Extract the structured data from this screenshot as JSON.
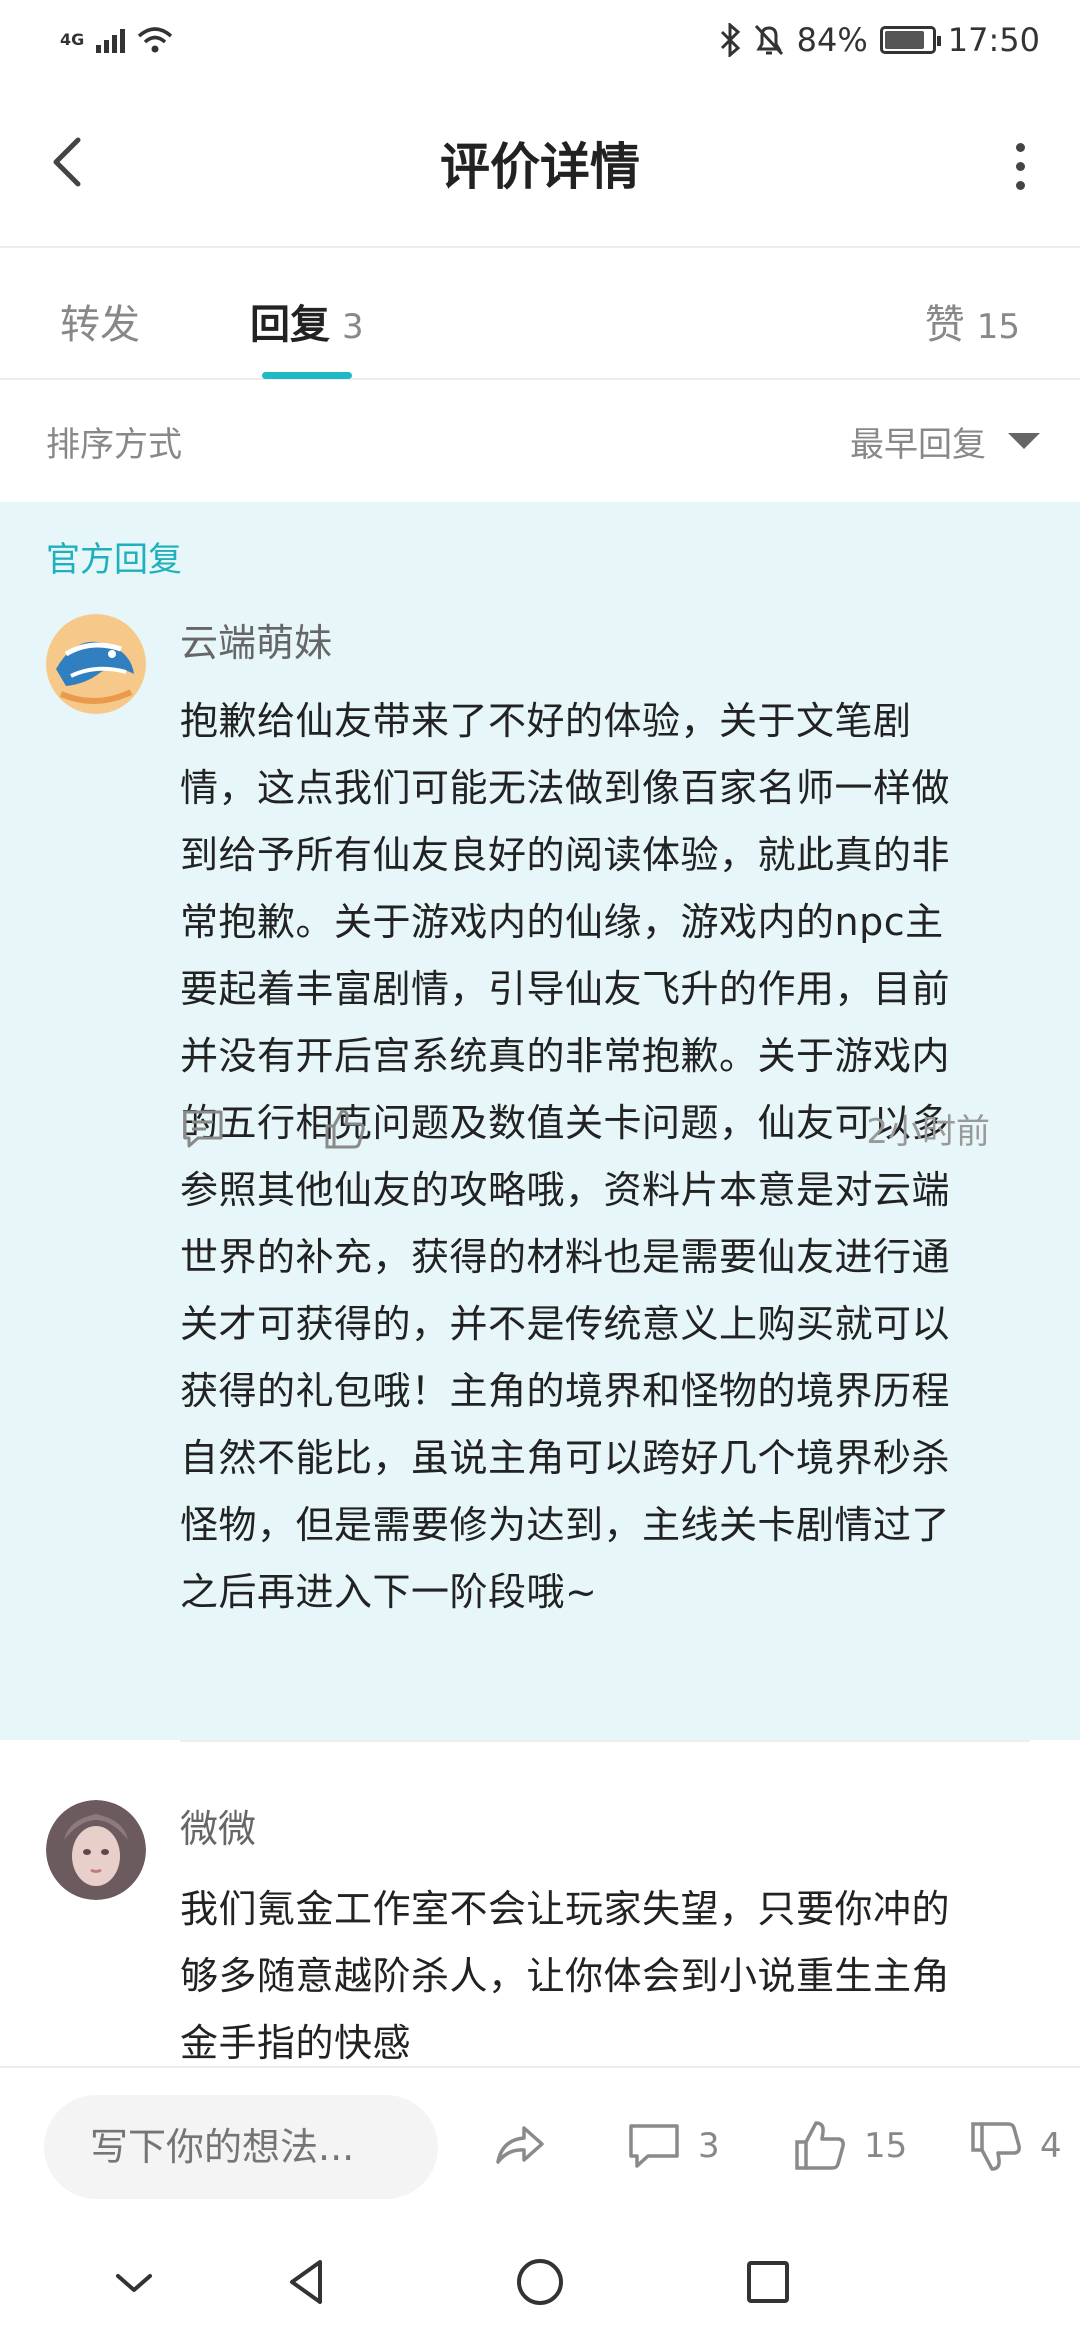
{
  "status_bar": {
    "network": "4G",
    "battery_percent": "84%",
    "battery_level": 0.84,
    "time": "17:50"
  },
  "header": {
    "title": "评价详情"
  },
  "tabs": [
    {
      "label": "转发",
      "count": ""
    },
    {
      "label": "回复",
      "count": "3"
    },
    {
      "label": "赞",
      "count": "15"
    }
  ],
  "sort": {
    "label": "排序方式",
    "value": "最早回复"
  },
  "official_reply": {
    "tag": "官方回复",
    "username": "云端萌妹",
    "lines": [
      "抱歉给仙友带来了不好的体验，关于文笔剧",
      "情，这点我们可能无法做到像百家名师一样做",
      "到给予所有仙友良好的阅读体验，就此真的非",
      "常抱歉。关于游戏内的仙缘，游戏内的npc主",
      "要起着丰富剧情，引导仙友飞升的作用，目前",
      "并没有开后宫系统真的非常抱歉。关于游戏内",
      "的五行相克问题及数值关卡问题，仙友可以多",
      "参照其他仙友的攻略哦，资料片本意是对云端",
      "世界的补充，获得的材料也是需要仙友进行通",
      "关才可获得的，并不是传统意义上购买就可以",
      "获得的礼包哦！主角的境界和怪物的境界历程",
      "自然不能比，虽说主角可以跨好几个境界秒杀",
      "怪物，但是需要修为达到，主线关卡剧情过了",
      "之后再进入下一阶段哦~"
    ],
    "time": "2小时前"
  },
  "reply_2": {
    "username": "微微",
    "lines": [
      "我们氪金工作室不会让玩家失望，只要你冲的",
      "够多随意越阶杀人，让你体会到小说重生主角",
      "金手指的快感"
    ]
  },
  "bottom_bar": {
    "input_placeholder": "写下你的想法...",
    "comment_count": "3",
    "like_count": "15",
    "dislike_count": "4"
  }
}
